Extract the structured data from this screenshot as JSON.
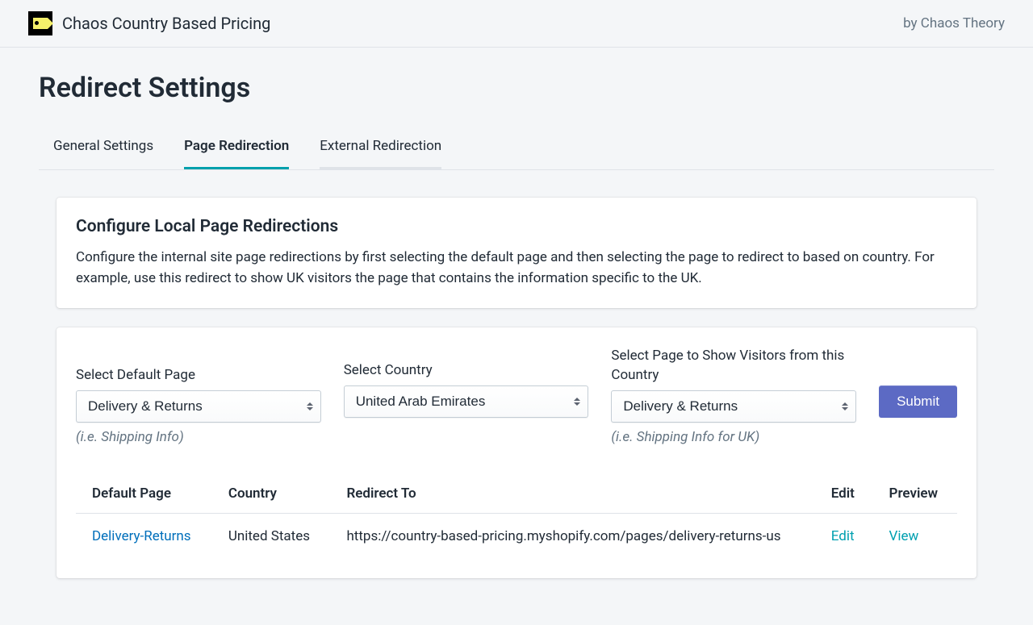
{
  "header": {
    "app_title": "Chaos Country Based Pricing",
    "byline": "by Chaos Theory"
  },
  "page_title": "Redirect Settings",
  "tabs": [
    {
      "label": "General Settings",
      "active": false
    },
    {
      "label": "Page Redirection",
      "active": true
    },
    {
      "label": "External Redirection",
      "active": false
    }
  ],
  "intro_card": {
    "title": "Configure Local Page Redirections",
    "description": "Configure the internal site page redirections by first selecting the default page and then selecting the page to redirect to based on country. For example, use this redirect to show UK visitors the page that contains the information specific to the UK."
  },
  "form": {
    "default_page": {
      "label": "Select Default Page",
      "value": "Delivery & Returns",
      "hint": "(i.e. Shipping Info)"
    },
    "country": {
      "label": "Select Country",
      "value": "United Arab Emirates"
    },
    "target_page": {
      "label": "Select Page to Show Visitors from this Country",
      "value": "Delivery & Returns",
      "hint": "(i.e. Shipping Info for UK)"
    },
    "submit_label": "Submit"
  },
  "table": {
    "headers": {
      "default_page": "Default Page",
      "country": "Country",
      "redirect_to": "Redirect To",
      "edit": "Edit",
      "preview": "Preview"
    },
    "rows": [
      {
        "default_page": "Delivery-Returns",
        "country": "United States",
        "redirect_to": "https://country-based-pricing.myshopify.com/pages/delivery-returns-us",
        "edit": "Edit",
        "preview": "View"
      }
    ]
  }
}
